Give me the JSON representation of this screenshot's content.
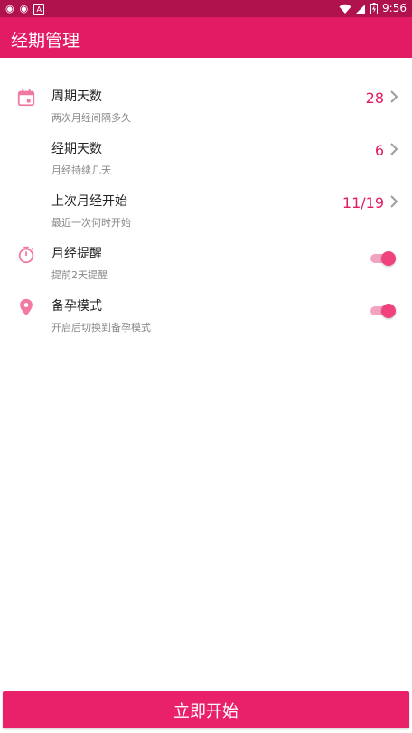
{
  "status_bar": {
    "time": "9:56",
    "left_icons": [
      "weibo-icon",
      "weibo-icon",
      "a-icon"
    ],
    "right_icons": [
      "wifi-icon",
      "signal-icon",
      "battery-icon"
    ]
  },
  "app_bar": {
    "title": "经期管理"
  },
  "settings": [
    {
      "title": "周期天数",
      "subtitle": "两次月经间隔多久",
      "value": "28",
      "icon": "calendar-icon"
    },
    {
      "title": "经期天数",
      "subtitle": "月经持续几天",
      "value": "6"
    },
    {
      "title": "上次月经开始",
      "subtitle": "最近一次何时开始",
      "value": "11/19"
    },
    {
      "title": "月经提醒",
      "subtitle": "提前2天提醒",
      "toggle_on": true,
      "icon": "timer-icon"
    },
    {
      "title": "备孕模式",
      "subtitle": "开启后切换到备孕模式",
      "toggle_on": true,
      "icon": "location-pin-icon"
    }
  ],
  "action": {
    "label": "立即开始"
  },
  "colors": {
    "primary": "#e21b64",
    "status_bar": "#b0124d",
    "icon": "#f07aa4",
    "toggle_thumb": "#f0427c",
    "toggle_track": "#f2a3c1"
  }
}
